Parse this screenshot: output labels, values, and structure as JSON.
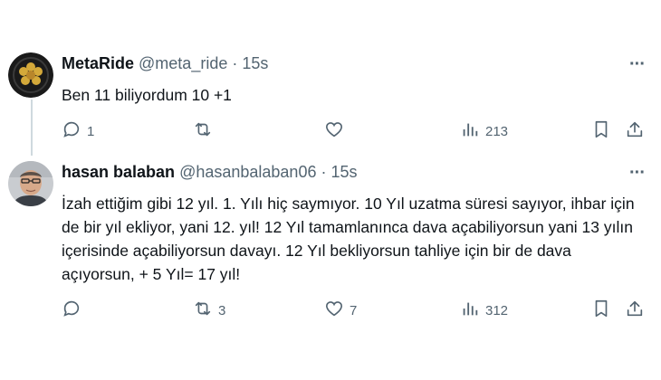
{
  "tweets": [
    {
      "name": "MetaRide",
      "handle": "@meta_ride",
      "dot": "·",
      "time": "15s",
      "more": "···",
      "text": "Ben 11 biliyordum 10 +1",
      "replies": "1",
      "retweets": "",
      "likes": "",
      "views": "213",
      "avatar_colors": {
        "bg": "#1a1a1a",
        "accent": "#d4a93a"
      }
    },
    {
      "name": "hasan balaban",
      "handle": "@hasanbalaban06",
      "dot": "·",
      "time": "15s",
      "more": "···",
      "text": "İzah ettiğim gibi 12 yıl. 1. Yılı hiç saymıyor. 10 Yıl uzatma süresi sayıyor, ihbar için de bir yıl ekliyor, yani 12. yıl! 12 Yıl tamamlanınca dava açabiliyorsun yani 13 yılın içerisinde açabiliyorsun davayı. 12 Yıl bekliyorsun tahliye için bir de dava açıyorsun, + 5 Yıl= 17 yıl!",
      "replies": "",
      "retweets": "3",
      "likes": "7",
      "views": "312"
    }
  ],
  "colors": {
    "text": "#0f1419",
    "secondary": "#536471",
    "thread_line": "#cfd9de"
  },
  "icons": [
    "reply-icon",
    "retweet-icon",
    "like-icon",
    "views-icon",
    "bookmark-icon",
    "share-icon"
  ]
}
